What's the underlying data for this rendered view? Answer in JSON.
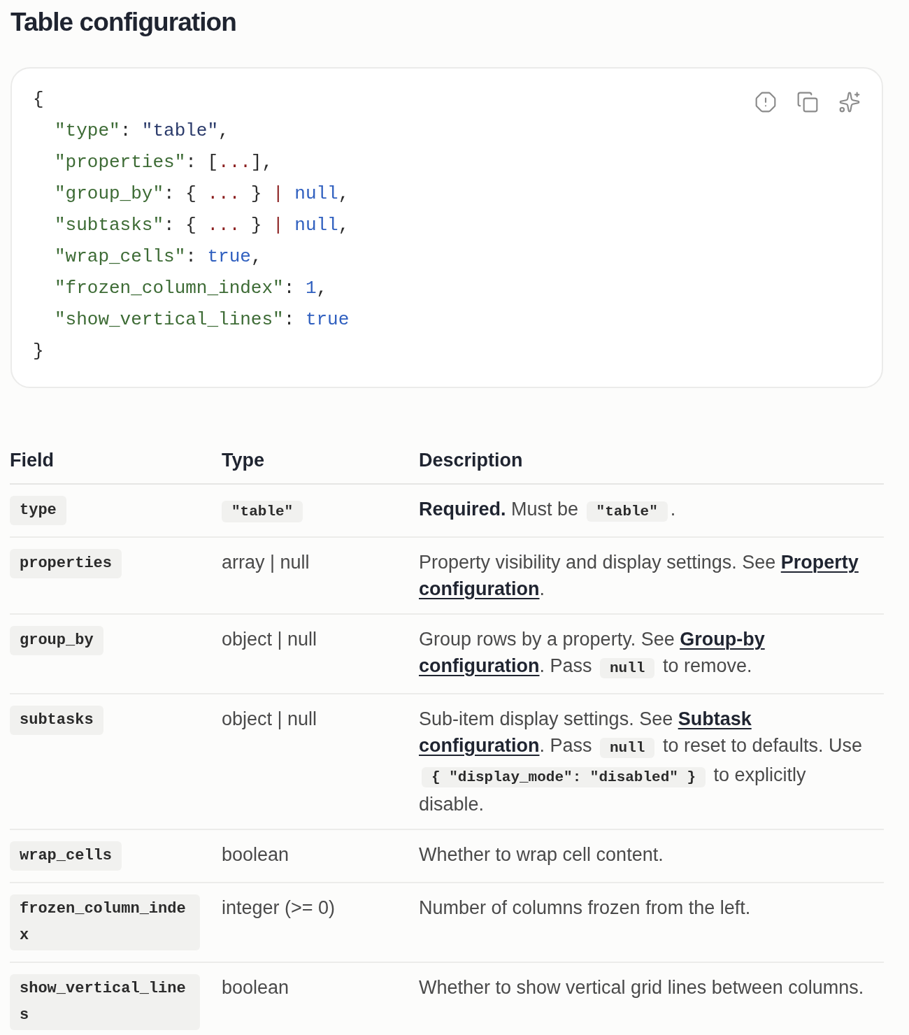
{
  "title": "Table configuration",
  "code_block": {
    "lines": [
      {
        "tokens": [
          {
            "kind": "punct",
            "text": "{"
          }
        ],
        "children": [
          {
            "tokens": [
              {
                "kind": "key",
                "text": "\"type\""
              },
              {
                "kind": "punct",
                "text": ": "
              },
              {
                "kind": "string",
                "text": "\"table\""
              },
              {
                "kind": "punct",
                "text": ","
              }
            ]
          },
          {
            "tokens": [
              {
                "kind": "key",
                "text": "\"properties\""
              },
              {
                "kind": "punct",
                "text": ": ["
              },
              {
                "kind": "ellipsis",
                "text": "..."
              },
              {
                "kind": "punct",
                "text": "],"
              }
            ]
          },
          {
            "tokens": [
              {
                "kind": "key",
                "text": "\"group_by\""
              },
              {
                "kind": "punct",
                "text": ": { "
              },
              {
                "kind": "ellipsis",
                "text": "..."
              },
              {
                "kind": "punct",
                "text": " } "
              },
              {
                "kind": "ellipsis",
                "text": "|"
              },
              {
                "kind": "keyword",
                "text": " null"
              },
              {
                "kind": "punct",
                "text": ","
              }
            ]
          },
          {
            "tokens": [
              {
                "kind": "key",
                "text": "\"subtasks\""
              },
              {
                "kind": "punct",
                "text": ": { "
              },
              {
                "kind": "ellipsis",
                "text": "..."
              },
              {
                "kind": "punct",
                "text": " } "
              },
              {
                "kind": "ellipsis",
                "text": "|"
              },
              {
                "kind": "keyword",
                "text": " null"
              },
              {
                "kind": "punct",
                "text": ","
              }
            ]
          },
          {
            "tokens": [
              {
                "kind": "key",
                "text": "\"wrap_cells\""
              },
              {
                "kind": "punct",
                "text": ": "
              },
              {
                "kind": "keyword",
                "text": "true"
              },
              {
                "kind": "punct",
                "text": ","
              }
            ]
          },
          {
            "tokens": [
              {
                "kind": "key",
                "text": "\"frozen_column_index\""
              },
              {
                "kind": "punct",
                "text": ": "
              },
              {
                "kind": "keyword",
                "text": "1"
              },
              {
                "kind": "punct",
                "text": ","
              }
            ]
          },
          {
            "tokens": [
              {
                "kind": "key",
                "text": "\"show_vertical_lines\""
              },
              {
                "kind": "punct",
                "text": ": "
              },
              {
                "kind": "keyword",
                "text": "true"
              }
            ]
          }
        ]
      },
      {
        "tokens": [
          {
            "kind": "punct",
            "text": "}"
          }
        ]
      }
    ],
    "actions": [
      {
        "kind": "report"
      },
      {
        "kind": "copy"
      },
      {
        "kind": "ai"
      }
    ]
  },
  "table": {
    "columns": [
      "Field",
      "Type",
      "Description"
    ],
    "rows": [
      {
        "field": "type",
        "type": {
          "kind": "code",
          "text": "\"table\""
        },
        "description": [
          {
            "kind": "bold",
            "text": "Required."
          },
          {
            "kind": "text",
            "text": " Must be "
          },
          {
            "kind": "code",
            "text": "\"table\""
          },
          {
            "kind": "text",
            "text": "."
          }
        ]
      },
      {
        "field": "properties",
        "type": {
          "kind": "text",
          "text": "array | null"
        },
        "description": [
          {
            "kind": "text",
            "text": "Property visibility and display settings. See "
          },
          {
            "kind": "link",
            "text": "Property configuration"
          },
          {
            "kind": "text",
            "text": "."
          }
        ]
      },
      {
        "field": "group_by",
        "type": {
          "kind": "text",
          "text": "object | null"
        },
        "description": [
          {
            "kind": "text",
            "text": "Group rows by a property. See "
          },
          {
            "kind": "link",
            "text": "Group-by configuration"
          },
          {
            "kind": "text",
            "text": ". Pass "
          },
          {
            "kind": "code",
            "text": "null"
          },
          {
            "kind": "text",
            "text": " to remove."
          }
        ]
      },
      {
        "field": "subtasks",
        "type": {
          "kind": "text",
          "text": "object | null"
        },
        "description": [
          {
            "kind": "text",
            "text": "Sub-item display settings. See "
          },
          {
            "kind": "link",
            "text": "Subtask configuration"
          },
          {
            "kind": "text",
            "text": ". Pass "
          },
          {
            "kind": "code",
            "text": "null"
          },
          {
            "kind": "text",
            "text": " to reset to defaults. Use "
          },
          {
            "kind": "code",
            "text": "{ \"display_mode\": \"disabled\" }"
          },
          {
            "kind": "text",
            "text": " to explicitly disable."
          }
        ]
      },
      {
        "field": "wrap_cells",
        "type": {
          "kind": "text",
          "text": "boolean"
        },
        "description": [
          {
            "kind": "text",
            "text": "Whether to wrap cell content."
          }
        ]
      },
      {
        "field": "frozen_column_index",
        "type": {
          "kind": "text",
          "text": "integer (>= 0)"
        },
        "description": [
          {
            "kind": "text",
            "text": "Number of columns frozen from the left."
          }
        ]
      },
      {
        "field": "show_vertical_lines",
        "type": {
          "kind": "text",
          "text": "boolean"
        },
        "description": [
          {
            "kind": "text",
            "text": "Whether to show vertical grid lines between columns."
          }
        ]
      }
    ]
  }
}
